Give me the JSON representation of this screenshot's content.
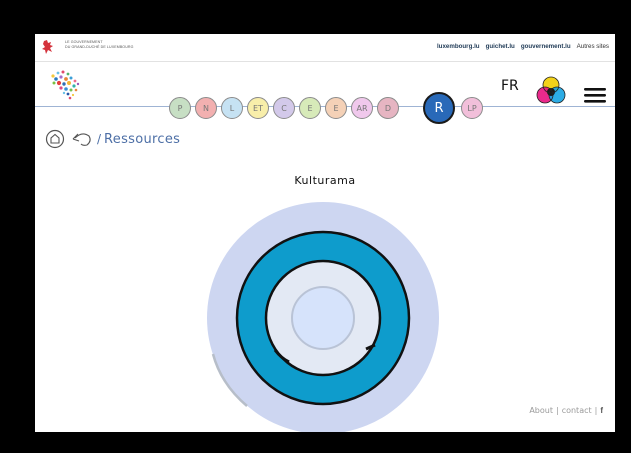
{
  "gov_bar": {
    "name_line1": "LE GOUVERNEMENT",
    "name_line2": "DU GRAND-DUCHÉ DE LUXEMBOURG",
    "links": [
      "luxembourg.lu",
      "guichet.lu",
      "gouvernement.lu"
    ],
    "other_sites": "Autres sites"
  },
  "header": {
    "language": "FR",
    "icons": [
      "site-logo-icon",
      "palette-icon",
      "menu-icon"
    ]
  },
  "nav": {
    "items": [
      {
        "label": "P",
        "color": "#c7dfc4"
      },
      {
        "label": "N",
        "color": "#f2b0b0"
      },
      {
        "label": "L",
        "color": "#c6e2f3"
      },
      {
        "label": "ET",
        "color": "#f8eeaa"
      },
      {
        "label": "C",
        "color": "#d3c9ea"
      },
      {
        "label": "E",
        "color": "#d7eab9"
      },
      {
        "label": "E",
        "color": "#f4d1b7"
      },
      {
        "label": "AR",
        "color": "#f0c8ec"
      },
      {
        "label": "D",
        "color": "#e6b5c2"
      },
      {
        "label": "R",
        "color": "#2969b8",
        "active": true
      },
      {
        "label": "LP",
        "color": "#f2bfda"
      }
    ]
  },
  "breadcrumb": {
    "separator": "/",
    "current": "Ressources"
  },
  "main": {
    "title": "Kulturama",
    "colors": {
      "outer_disc": "#cdd6f1",
      "ring": "#0e9ccc",
      "inner_disc": "#e3e9f4",
      "center": "#d6e3fb"
    }
  },
  "footer": {
    "about": "About",
    "sep": "|",
    "contact": "contact",
    "facebook": "f"
  }
}
